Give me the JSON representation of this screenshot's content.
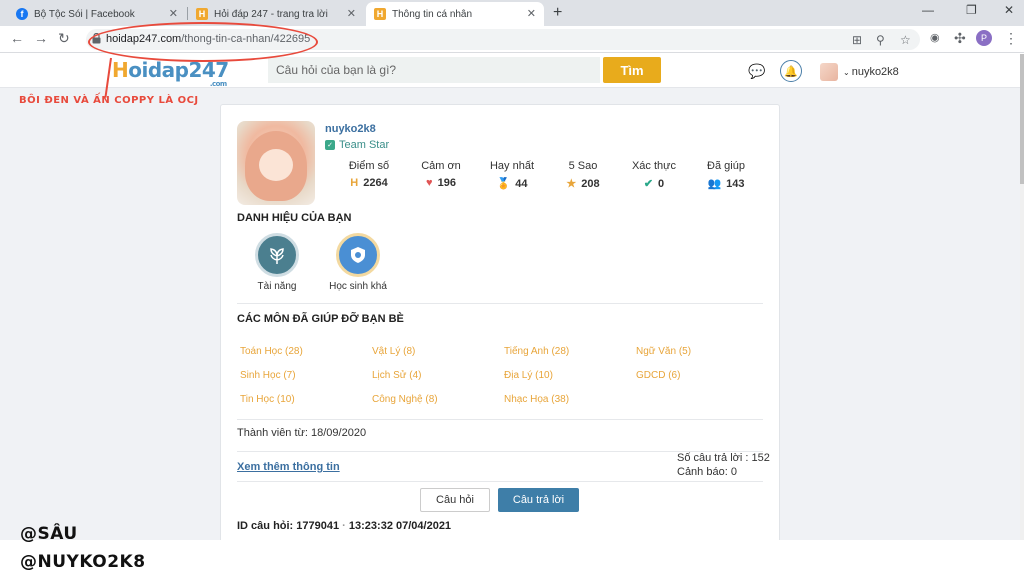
{
  "browser": {
    "tabs": [
      {
        "title": "Bộ Tộc Sói | Facebook"
      },
      {
        "title": "Hỏi đáp 247 - trang tra lời"
      },
      {
        "title": "Thông tin cá nhân"
      }
    ],
    "url_host": "hoidap247.com",
    "url_path": "/thong-tin-ca-nhan/422695",
    "profile_initial": "P"
  },
  "site": {
    "logo_main": "oidap247",
    "logo_h": "H",
    "logo_suffix": ".com",
    "search_placeholder": "Câu hỏi của bạn là gì?",
    "search_button": "Tìm",
    "username": "nuyko2k8"
  },
  "annotation": {
    "text": "BÔI ĐEN VÀ ẤN COPPY LÀ OCJ"
  },
  "profile": {
    "username": "nuyko2k8",
    "rank": "Team Star",
    "stats": [
      {
        "label": "Điểm số",
        "value": "2264",
        "icon": "score-icon",
        "color": "#e8a53a"
      },
      {
        "label": "Cảm ơn",
        "value": "196",
        "icon": "heart-icon",
        "color": "#e05555"
      },
      {
        "label": "Hay nhất",
        "value": "44",
        "icon": "medal-icon",
        "color": "#e8a53a"
      },
      {
        "label": "5 Sao",
        "value": "208",
        "icon": "star-icon",
        "color": "#e8a53a"
      },
      {
        "label": "Xác thực",
        "value": "0",
        "icon": "check-icon",
        "color": "#2aa88a"
      },
      {
        "label": "Đã giúp",
        "value": "143",
        "icon": "people-icon",
        "color": "#3e7ea8"
      }
    ],
    "titles_heading": "DANH HIỆU CỦA BẠN",
    "titles": [
      {
        "name": "Tài năng",
        "icon": "leaf-badge-icon"
      },
      {
        "name": "Học sinh khá",
        "icon": "shield-badge-icon"
      }
    ],
    "subjects_heading": "CÁC MÔN ĐÃ GIÚP ĐỠ BẠN BÈ",
    "subjects": [
      "Toán Học (28)",
      "Vật Lý (8)",
      "Tiếng Anh (28)",
      "Ngữ Văn (5)",
      "Sinh Học (7)",
      "Lịch Sử (4)",
      "Địa Lý (10)",
      "GDCD (6)",
      "Tin Học (10)",
      "Công Nghệ (8)",
      "Nhạc Họa (38)"
    ],
    "member_since": "Thành viên từ: 18/09/2020",
    "more_info": "Xem thêm thông tin",
    "answer_count": "Số câu trả lời : 152",
    "warnings": "Cảnh báo: 0",
    "tab_questions": "Câu hỏi",
    "tab_answers": "Câu trả lời",
    "question_id": "ID câu hỏi: 1779041",
    "question_time": "13:23:32 07/04/2021"
  },
  "watermark": {
    "line1": "@SÂU",
    "line2": "@NUYKO2K8"
  }
}
